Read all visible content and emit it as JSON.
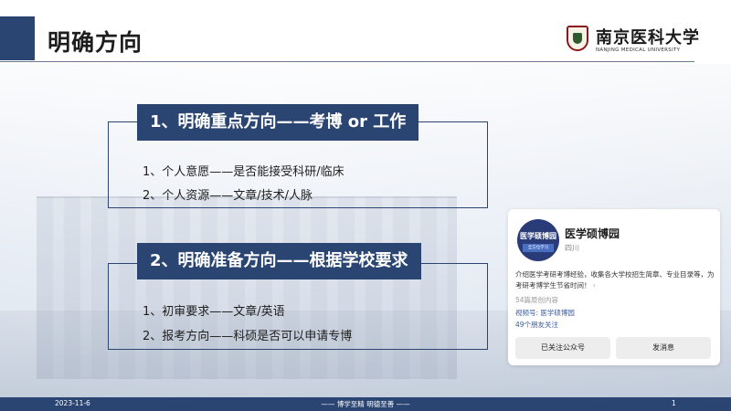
{
  "header": {
    "title": "明确方向"
  },
  "logo": {
    "name_cn": "南京医科大学",
    "name_en": "NANJING MEDICAL UNIVERSITY"
  },
  "section1": {
    "title": "1、明确重点方向——考博 or 工作",
    "items": [
      "1、个人意愿——是否能接受科研/临床",
      "2、个人资源——文章/技术/人脉"
    ]
  },
  "section2": {
    "title": "2、明确准备方向——根据学校要求",
    "items": [
      "1、初审要求——文章/英语",
      "2、报考方向——科硕是否可以申请专博"
    ]
  },
  "card": {
    "avatar_name": "医学硕博园",
    "avatar_tag": "全方位学习",
    "name": "医学硕博园",
    "region": "四川",
    "description": "介绍医学考研考博经验，收集各大学校招生简章、专业目录等，为考研考博学生节省时间！",
    "posts": "54篇原创内容",
    "video_channel": "视频号: 医学硕博园",
    "friends": "49个朋友关注",
    "follow_button": "已关注公众号",
    "message_button": "发消息"
  },
  "footer": {
    "date": "2023-11-6",
    "slogan": "—— 博学至精 明德至善 ——",
    "page": "1"
  },
  "colors": {
    "accent": "#2b4572",
    "footer": "#2b4572",
    "link": "#3a5aa0"
  }
}
